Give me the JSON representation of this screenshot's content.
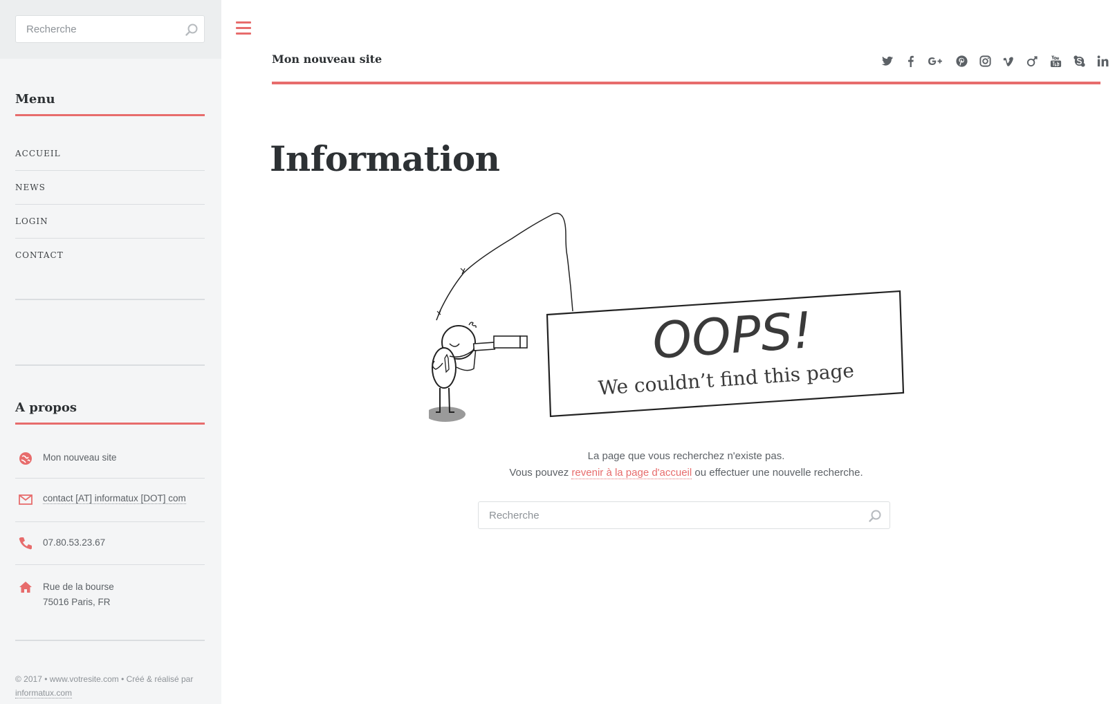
{
  "sidebar": {
    "search": {
      "placeholder": "Recherche"
    },
    "menu": {
      "title": "Menu",
      "items": [
        {
          "label": "ACCUEIL"
        },
        {
          "label": "NEWS"
        },
        {
          "label": "LOGIN"
        },
        {
          "label": "CONTACT"
        }
      ]
    },
    "about": {
      "title": "A propos",
      "site": "Mon nouveau site",
      "email": "contact [AT] informatux [DOT] com",
      "phone": "07.80.53.23.67",
      "address_line1": "Rue de la bourse",
      "address_line2": "75016 Paris, FR"
    },
    "footer": {
      "text": "© 2017 • www.votresite.com • Créé & réalisé par",
      "link": "informatux.com"
    }
  },
  "header": {
    "site_title": "Mon nouveau site",
    "social": [
      "twitter-icon",
      "facebook-icon",
      "google-plus-icon",
      "pinterest-icon",
      "instagram-icon",
      "vimeo-icon",
      "foursquare-icon",
      "youtube-icon",
      "skype-icon",
      "linkedin-icon"
    ]
  },
  "main": {
    "title": "Information",
    "illustration": {
      "heading": "OOPS!",
      "subheading": "We couldn’t find this page"
    },
    "message_line1": "La page que vous recherchez n'existe pas.",
    "message_line2_pre": "Vous pouvez",
    "message_link": "revenir à la page d'accueil",
    "message_line2_post": "ou effectuer une nouvelle recherche.",
    "search": {
      "placeholder": "Recherche"
    }
  },
  "colors": {
    "accent": "#e76c6c",
    "sidebar_bg": "#f4f5f6",
    "text": "#3d4144"
  }
}
